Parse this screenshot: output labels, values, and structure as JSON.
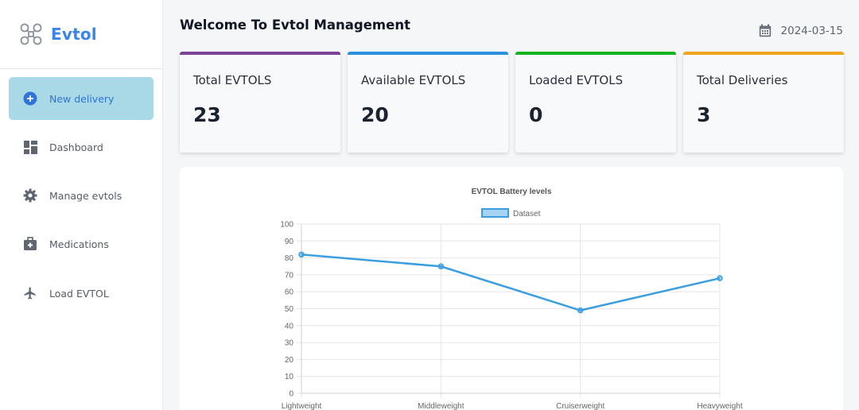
{
  "brand": {
    "name": "Evtol",
    "icon": "drone-icon"
  },
  "sidebar": {
    "items": [
      {
        "label": "New delivery",
        "icon": "plus-circle-icon",
        "active": true
      },
      {
        "label": "Dashboard",
        "icon": "dashboard-icon",
        "active": false
      },
      {
        "label": "Manage evtols",
        "icon": "gear-icon",
        "active": false
      },
      {
        "label": "Medications",
        "icon": "medkit-icon",
        "active": false
      },
      {
        "label": "Load EVTOL",
        "icon": "airplane-icon",
        "active": false
      }
    ]
  },
  "header": {
    "title": "Welcome To Evtol Management",
    "date": "2024-03-15",
    "date_icon": "calendar-icon"
  },
  "cards": [
    {
      "label": "Total EVTOLS",
      "value": "23",
      "color": "#7b4397"
    },
    {
      "label": "Available EVTOLS",
      "value": "20",
      "color": "#2b8fe0"
    },
    {
      "label": "Loaded EVTOLS",
      "value": "0",
      "color": "#17b21f"
    },
    {
      "label": "Total Deliveries",
      "value": "3",
      "color": "#f0a51c"
    }
  ],
  "colors": {
    "accent": "#3a86e8",
    "active_nav_bg": "#a9d8e6",
    "line": "#3a9ee0"
  },
  "chart_data": {
    "type": "line",
    "title": "EVTOL Battery levels",
    "categories": [
      "Lightweight",
      "Middleweight",
      "Cruiserweight",
      "Heavyweight"
    ],
    "series": [
      {
        "name": "Dataset",
        "values": [
          82,
          75,
          49,
          68
        ]
      }
    ],
    "ylim": [
      0,
      100
    ],
    "yticks": [
      0,
      10,
      20,
      30,
      40,
      50,
      60,
      70,
      80,
      90,
      100
    ],
    "xlabel": "",
    "ylabel": "",
    "grid": true,
    "legend": "top-center"
  }
}
